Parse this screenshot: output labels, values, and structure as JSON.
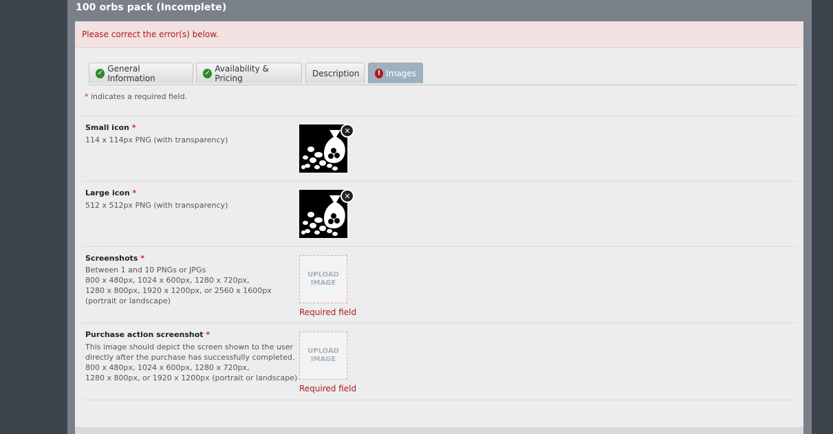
{
  "dialog": {
    "title": "100 orbs pack (Incomplete)"
  },
  "error": {
    "message": "Please correct the error(s) below."
  },
  "tabs": [
    {
      "label": "General Information",
      "status": "complete",
      "icon": "check-icon"
    },
    {
      "label": "Availability & Pricing",
      "status": "complete",
      "icon": "check-icon"
    },
    {
      "label": "Description",
      "status": "none",
      "icon": ""
    },
    {
      "label": "Images",
      "status": "error",
      "icon": "error-icon",
      "active": true
    }
  ],
  "required_note": {
    "star": "*",
    "text": " indicates a required field."
  },
  "fields": {
    "small_icon": {
      "title": "Small icon",
      "star": "*",
      "desc": "114 x 114px PNG (with transparency)",
      "state": "uploaded"
    },
    "large_icon": {
      "title": "Large icon",
      "star": "*",
      "desc": "512 x 512px PNG (with transparency)",
      "state": "uploaded"
    },
    "screenshots": {
      "title": "Screenshots",
      "star": "*",
      "desc": "Between 1 and 10 PNGs or JPGs\n800 x 480px, 1024 x 600px, 1280 x 720px,\n1280 x 800px, 1920 x 1200px, or 2560 x 1600px\n(portrait or landscape)",
      "upload_line1": "UPLOAD",
      "upload_line2": "IMAGE",
      "error": "Required field"
    },
    "purchase_screenshot": {
      "title": "Purchase action screenshot",
      "star": "*",
      "desc": "This image should depict the screen shown to the user\ndirectly after the purchase has successfully completed.\n800 x 480px, 1024 x 600px, 1280 x 720px,\n1280 x 800px, or 1920 x 1200px (portrait or landscape)",
      "upload_line1": "UPLOAD",
      "upload_line2": "IMAGE",
      "error": "Required field"
    }
  },
  "colors": {
    "error": "#b01a1a",
    "active_tab": "#9fb1bf",
    "ok": "#2e8a2e"
  }
}
